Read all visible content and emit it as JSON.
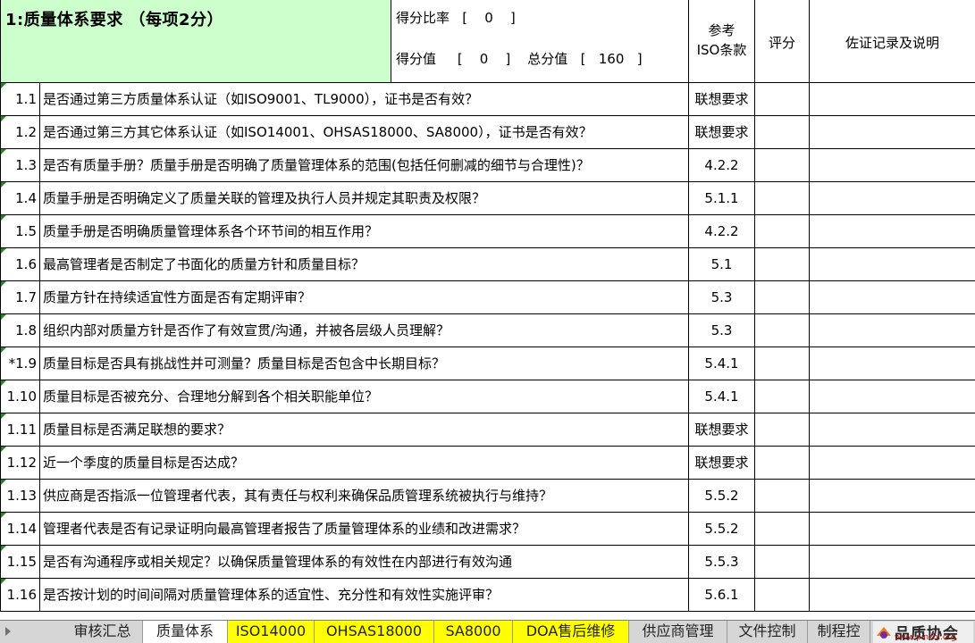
{
  "header": {
    "title": "1:质量体系要求 （每项2分）",
    "score_ratio_line": "得分比率   [    0    ]",
    "score_value_line": "得分值     [    0    ]    总分值   [   160   ]",
    "ref_label_1": "参考",
    "ref_label_2": "ISO条款",
    "grade_label": "评分",
    "note_label": "佐证记录及说明"
  },
  "rows": [
    {
      "num": "1.1",
      "question": "是否通过第三方质量体系认证（如ISO9001、TL9000），证书是否有效？",
      "ref": "联想要求"
    },
    {
      "num": "1.2",
      "question": "是否通过第三方其它体系认证（如ISO14001、OHSAS18000、SA8000），证书是否有效？",
      "ref": "联想要求"
    },
    {
      "num": "1.3",
      "question": "是否有质量手册？质量手册是否明确了质量管理体系的范围(包括任何删减的细节与合理性)？",
      "ref": "4.2.2"
    },
    {
      "num": "1.4",
      "question": "质量手册是否明确定义了质量关联的管理及执行人员并规定其职责及权限？",
      "ref": "5.1.1"
    },
    {
      "num": "1.5",
      "question": "质量手册是否明确质量管理体系各个环节间的相互作用？",
      "ref": "4.2.2"
    },
    {
      "num": "1.6",
      "question": "最高管理者是否制定了书面化的质量方针和质量目标？",
      "ref": "5.1"
    },
    {
      "num": "1.7",
      "question": "质量方针在持续适宜性方面是否有定期评审？",
      "ref": "5.3"
    },
    {
      "num": "1.8",
      "question": "组织内部对质量方针是否作了有效宣贯/沟通，并被各层级人员理解？",
      "ref": "5.3"
    },
    {
      "num": "*1.9",
      "question": "质量目标是否具有挑战性并可测量？质量目标是否包含中长期目标？",
      "ref": "5.4.1"
    },
    {
      "num": "1.10",
      "question": "质量目标是否被充分、合理地分解到各个相关职能单位？",
      "ref": "5.4.1"
    },
    {
      "num": "1.11",
      "question": "质量目标是否满足联想的要求？",
      "ref": "联想要求"
    },
    {
      "num": "1.12",
      "question": "近一个季度的质量目标是否达成？",
      "ref": "联想要求"
    },
    {
      "num": "1.13",
      "question": "供应商是否指派一位管理者代表，其有责任与权利来确保品质管理系统被执行与维持？",
      "ref": "5.5.2"
    },
    {
      "num": "1.14",
      "question": "管理者代表是否有记录证明向最高管理者报告了质量管理体系的业绩和改进需求？",
      "ref": "5.5.2"
    },
    {
      "num": "1.15",
      "question": "是否有沟通程序或相关规定？以确保质量管理体系的有效性在内部进行有效沟通",
      "ref": "5.5.3"
    },
    {
      "num": "1.16",
      "question": "是否按计划的时间间隔对质量管理体系的适宜性、充分性和有效性实施评审？",
      "ref": "5.6.1"
    }
  ],
  "tabs": [
    {
      "label": "审核汇总",
      "style": "grey"
    },
    {
      "label": "质量体系",
      "style": "active"
    },
    {
      "label": "ISO14000",
      "style": "yellow"
    },
    {
      "label": "OHSAS18000",
      "style": "yellow"
    },
    {
      "label": "SA8000",
      "style": "yellow"
    },
    {
      "label": "DOA售后维修",
      "style": "yellow"
    },
    {
      "label": "供应商管理",
      "style": "grey"
    },
    {
      "label": "文件控制",
      "style": "grey"
    },
    {
      "label": "制程控",
      "style": "grey"
    }
  ],
  "watermark": {
    "text": "品质协会",
    "url": "www.pinzhi.org"
  },
  "colors": {
    "header_green": "#ccffcc",
    "tab_yellow": "#ffff00",
    "comment_marker": "#1e8a1e"
  }
}
